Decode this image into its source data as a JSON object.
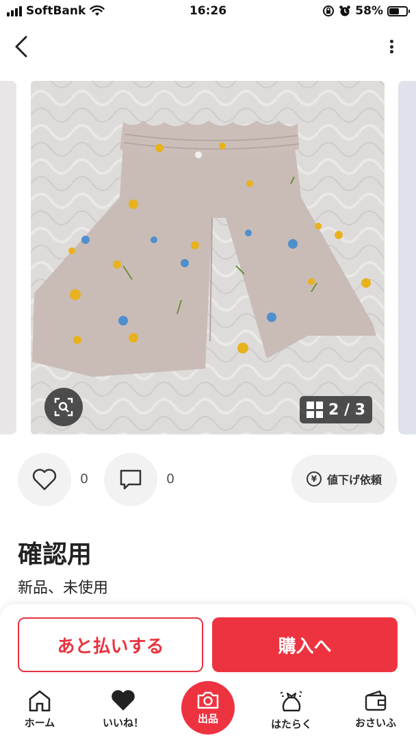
{
  "status_bar": {
    "carrier": "SoftBank",
    "time": "16:26",
    "battery_percent": "58%",
    "battery_level": 0.58
  },
  "gallery": {
    "counter": "2 / 3",
    "current_index": 2,
    "total": 3
  },
  "actions": {
    "like_count": "0",
    "comment_count": "0",
    "price_down_label": "値下げ依頼",
    "yen_symbol": "¥"
  },
  "item": {
    "title": "確認用",
    "condition": "新品、未使用"
  },
  "purchase": {
    "pay_later_label": "あと払いする",
    "buy_label": "購入へ"
  },
  "tabbar": {
    "home": "ホーム",
    "likes": "いいね！",
    "sell": "出品",
    "work": "はたらく",
    "wallet": "おさいふ"
  },
  "colors": {
    "accent": "#ee3340",
    "pant_fabric": "#c9bcb6",
    "flower_yellow": "#e8b21f",
    "flower_blue": "#4f8fce"
  },
  "icons": [
    "signal-icon",
    "wifi-icon",
    "orientation-lock-icon",
    "alarm-icon",
    "battery-icon",
    "back-chevron-icon",
    "more-vertical-icon",
    "zoom-scan-icon",
    "grid-icon",
    "heart-icon",
    "comment-icon",
    "yen-icon",
    "home-icon",
    "heart-filled-icon",
    "camera-icon",
    "money-bag-icon",
    "wallet-icon"
  ]
}
